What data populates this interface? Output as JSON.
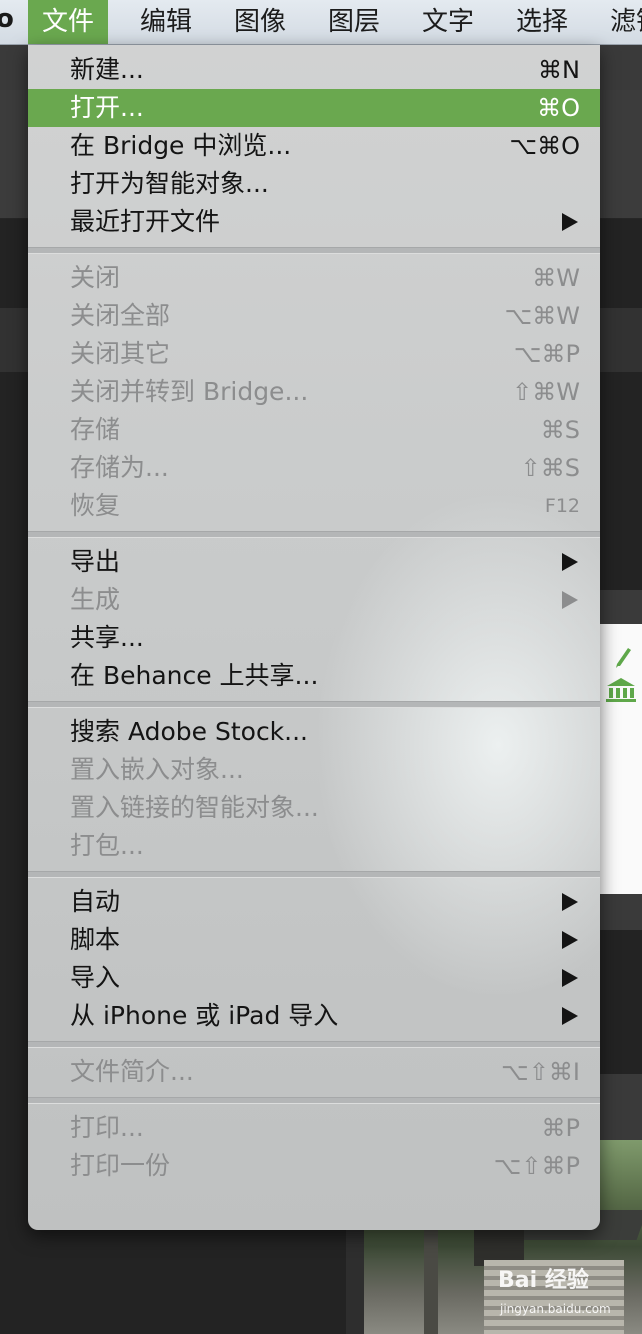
{
  "menubar": {
    "apple_fragment": "o",
    "items": [
      "文件",
      "编辑",
      "图像",
      "图层",
      "文字",
      "选择",
      "滤镜"
    ],
    "active_index": 0,
    "accent": "#6aa84f"
  },
  "menu": {
    "highlight_color": "#6aa84f",
    "groups": [
      [
        {
          "label": "新建...",
          "shortcut": "⌘N",
          "enabled": true
        },
        {
          "label": "打开...",
          "shortcut": "⌘O",
          "enabled": true,
          "highlighted": true
        },
        {
          "label": "在 Bridge 中浏览...",
          "shortcut": "⌥⌘O",
          "enabled": true
        },
        {
          "label": "打开为智能对象...",
          "shortcut": "",
          "enabled": true
        },
        {
          "label": "最近打开文件",
          "shortcut": "",
          "enabled": true,
          "submenu": true
        }
      ],
      [
        {
          "label": "关闭",
          "shortcut": "⌘W",
          "enabled": false
        },
        {
          "label": "关闭全部",
          "shortcut": "⌥⌘W",
          "enabled": false
        },
        {
          "label": "关闭其它",
          "shortcut": "⌥⌘P",
          "enabled": false
        },
        {
          "label": "关闭并转到 Bridge...",
          "shortcut": "⇧⌘W",
          "enabled": false
        },
        {
          "label": "存储",
          "shortcut": "⌘S",
          "enabled": false
        },
        {
          "label": "存储为...",
          "shortcut": "⇧⌘S",
          "enabled": false
        },
        {
          "label": "恢复",
          "shortcut": "F12",
          "enabled": false
        }
      ],
      [
        {
          "label": "导出",
          "shortcut": "",
          "enabled": true,
          "submenu": true
        },
        {
          "label": "生成",
          "shortcut": "",
          "enabled": false,
          "submenu": true
        },
        {
          "label": "共享...",
          "shortcut": "",
          "enabled": true
        },
        {
          "label": "在 Behance 上共享...",
          "shortcut": "",
          "enabled": true
        }
      ],
      [
        {
          "label": "搜索 Adobe Stock...",
          "shortcut": "",
          "enabled": true
        },
        {
          "label": "置入嵌入对象...",
          "shortcut": "",
          "enabled": false
        },
        {
          "label": "置入链接的智能对象...",
          "shortcut": "",
          "enabled": false
        },
        {
          "label": "打包...",
          "shortcut": "",
          "enabled": false
        }
      ],
      [
        {
          "label": "自动",
          "shortcut": "",
          "enabled": true,
          "submenu": true
        },
        {
          "label": "脚本",
          "shortcut": "",
          "enabled": true,
          "submenu": true
        },
        {
          "label": "导入",
          "shortcut": "",
          "enabled": true,
          "submenu": true
        },
        {
          "label": "从 iPhone 或 iPad 导入",
          "shortcut": "",
          "enabled": true,
          "submenu": true
        }
      ],
      [
        {
          "label": "文件简介...",
          "shortcut": "⌥⇧⌘I",
          "enabled": false
        }
      ],
      [
        {
          "label": "打印...",
          "shortcut": "⌘P",
          "enabled": false
        },
        {
          "label": "打印一份",
          "shortcut": "⌥⇧⌘P",
          "enabled": false
        }
      ]
    ]
  },
  "watermark": {
    "main": "Bai 经验",
    "sub": "jingyan.baidu.com"
  },
  "icons": [
    "pencil-icon",
    "building-icon",
    "submenu-arrow-icon"
  ]
}
